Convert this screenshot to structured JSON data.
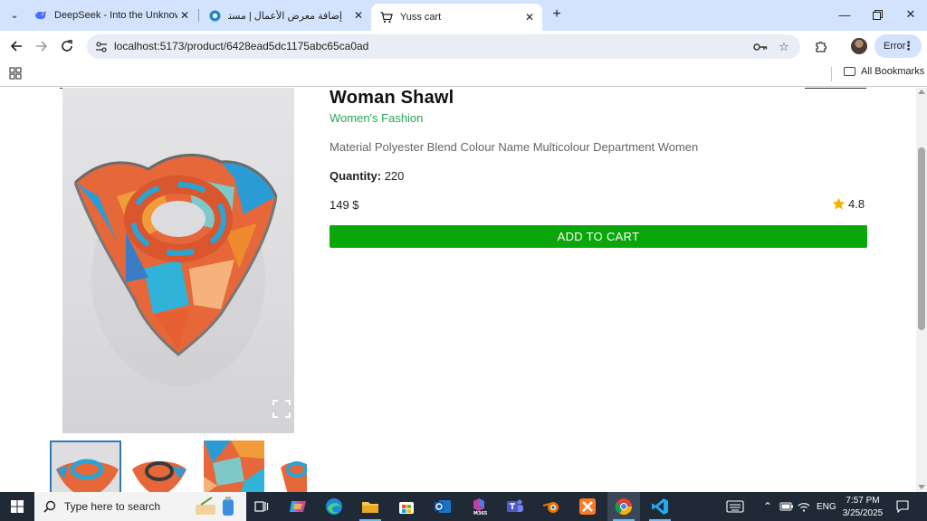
{
  "browser": {
    "tabs": [
      {
        "title": "DeepSeek - Into the Unknown",
        "icon": "deepseek-whale-icon",
        "active": false
      },
      {
        "title": "إضافة معرض الأعمال | مستقل",
        "icon": "mostaql-circle-icon",
        "active": false
      },
      {
        "title": "Yuss cart",
        "icon": "cart-icon",
        "active": true
      }
    ],
    "new_tab_label": "+",
    "url": "localhost:5173/product/6428ead5dc1175abc65ca0ad",
    "profile_label": "Error",
    "bookmarks_all_label": "All Bookmarks"
  },
  "product": {
    "title": "Woman Shawl",
    "category": "Women's Fashion",
    "description": "Material Polyester Blend Colour Name Multicolour Department Women",
    "quantity_label": "Quantity:",
    "quantity_value": "220",
    "price": "149 $",
    "rating": "4.8",
    "add_to_cart_label": "ADD TO CART",
    "thumbnails": [
      "thumb-1",
      "thumb-2",
      "thumb-3",
      "thumb-4"
    ]
  },
  "taskbar": {
    "search_placeholder": "Type here to search",
    "language": "ENG",
    "time": "7:57 PM",
    "date": "3/25/2025",
    "apps": [
      "task-view-icon",
      "copilot-icon",
      "edge-icon",
      "file-explorer-icon",
      "store-icon",
      "outlook-icon",
      "m365-icon",
      "teams-icon",
      "blender-icon",
      "xampp-icon",
      "chrome-icon",
      "vscode-icon"
    ]
  },
  "colors": {
    "accent_green": "#0aa60a",
    "category_green": "#22a94e",
    "tabbar_blue": "#d3e3fd",
    "taskbar_bg": "#1f2a36",
    "star_gold": "#f5b301"
  }
}
